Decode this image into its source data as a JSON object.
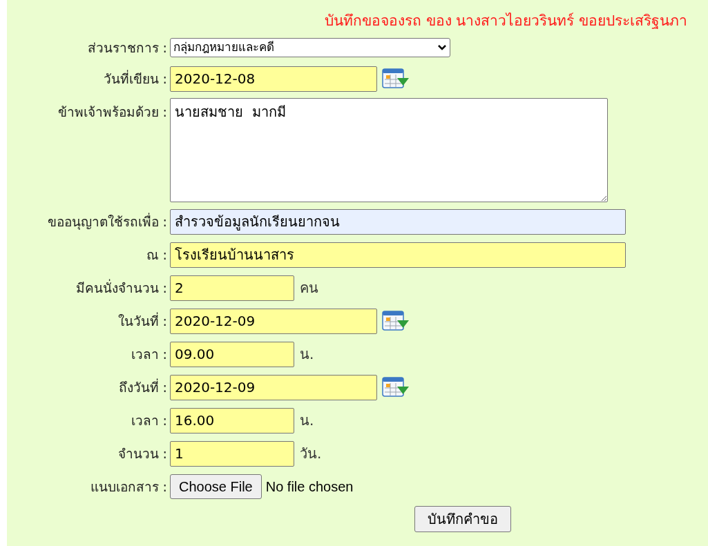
{
  "title": "บันทึกขอจองรถ ของ นางสาวไอยวรินทร์ ขอยประเสริฐนภา",
  "fields": [
    {
      "kind": "select",
      "label": "ส่วนราชการ :",
      "value": "กลุ่มกฎหมายและคดี"
    },
    {
      "kind": "date",
      "label": "วันที่เขียน :",
      "value": "2020-12-08"
    },
    {
      "kind": "textarea",
      "label": "ข้าพเจ้าพร้อมด้วย :",
      "value": "นายสมชาย  มากมี"
    },
    {
      "kind": "wide",
      "label": "ขออนุญาตใช้รถเพื่อ :",
      "value": "สำรวจข้อมูลนักเรียนยากจน",
      "autofilled": true
    },
    {
      "kind": "wide",
      "label": "ณ :",
      "value": "โรงเรียนบ้านนาสาร",
      "autofilled": false
    },
    {
      "kind": "short",
      "label": "มีคนนั่งจำนวน :",
      "value": "2",
      "unit": "คน"
    },
    {
      "kind": "date",
      "label": "ในวันที่ :",
      "value": "2020-12-09"
    },
    {
      "kind": "short",
      "label": "เวลา :",
      "value": "09.00",
      "unit": "น."
    },
    {
      "kind": "date",
      "label": "ถึงวันที่ :",
      "value": "2020-12-09"
    },
    {
      "kind": "short",
      "label": "เวลา :",
      "value": "16.00",
      "unit": "น."
    },
    {
      "kind": "short",
      "label": "จำนวน :",
      "value": "1",
      "unit": "วัน."
    },
    {
      "kind": "file",
      "label": "แนบเอกสาร :",
      "button": "Choose File",
      "status": "No file chosen"
    }
  ],
  "submit": "บันทึกคำขอ"
}
